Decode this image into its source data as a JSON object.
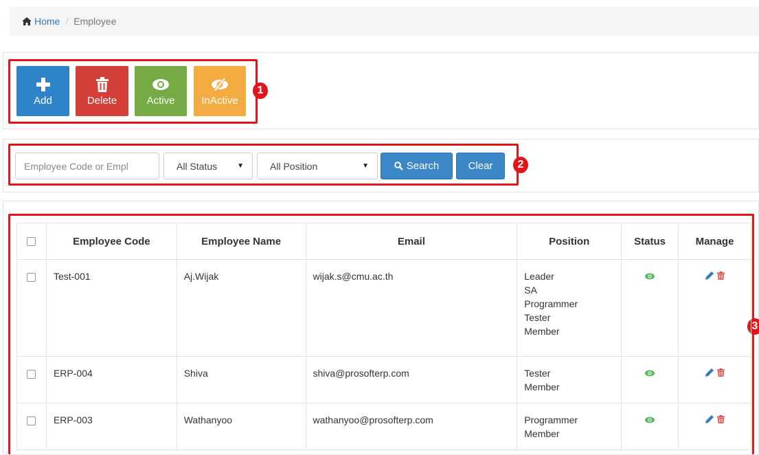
{
  "breadcrumb": {
    "home": "Home",
    "separator": "/",
    "current": "Employee"
  },
  "toolbar": {
    "add_label": "Add",
    "delete_label": "Delete",
    "active_label": "Active",
    "inactive_label": "InActive",
    "colors": {
      "add": "#2f83c8",
      "delete": "#d43f3a",
      "active": "#75aa44",
      "inactive": "#f3ac42"
    }
  },
  "filters": {
    "search_placeholder": "Employee Code or Empl",
    "status_selected": "All Status",
    "position_selected": "All Position",
    "search_label": "Search",
    "clear_label": "Clear"
  },
  "annotations": [
    "1",
    "2",
    "3"
  ],
  "table": {
    "columns": [
      "Employee Code",
      "Employee Name",
      "Email",
      "Position",
      "Status",
      "Manage"
    ],
    "rows": [
      {
        "code": "Test-001",
        "name": "Aj.Wijak",
        "email": "wijak.s@cmu.ac.th",
        "positions": [
          "Leader",
          "SA",
          "Programmer",
          "Tester",
          "Member"
        ]
      },
      {
        "code": "ERP-004",
        "name": "Shiva",
        "email": "shiva@prosofterp.com",
        "positions": [
          "Tester",
          "Member"
        ]
      },
      {
        "code": "ERP-003",
        "name": "Wathanyoo",
        "email": "wathanyoo@prosofterp.com",
        "positions": [
          "Programmer",
          "Member"
        ]
      }
    ]
  },
  "icons": {
    "status": "eye-icon",
    "edit": "pencil-icon",
    "delete": "trash-icon",
    "home": "home-icon"
  },
  "colors": {
    "accent": "#337ab7",
    "highlight": "#e1161b"
  }
}
